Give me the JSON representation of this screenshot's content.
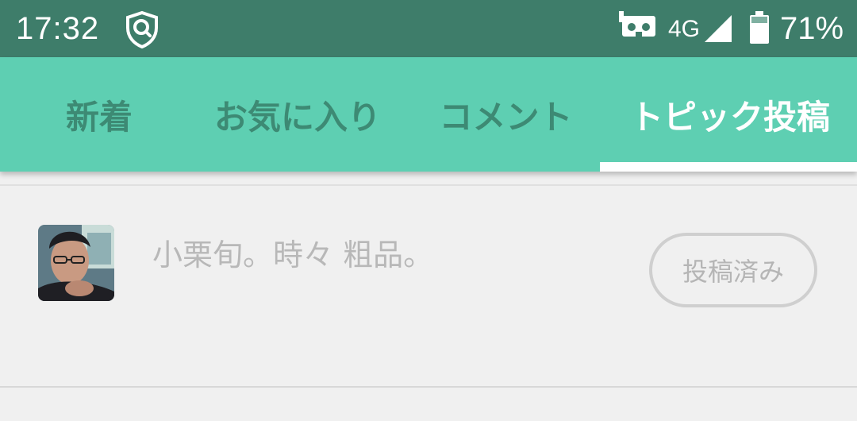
{
  "status_bar": {
    "time": "17:32",
    "shield_icon": "shield-search-icon",
    "vr_icon": "vr-headset-icon",
    "network": "4G",
    "signal_icon": "signal-icon",
    "battery_icon": "battery-icon",
    "battery_percent": "71%"
  },
  "tabs": [
    {
      "label": "新着",
      "active": false
    },
    {
      "label": "お気に入り",
      "active": false
    },
    {
      "label": "コメント",
      "active": false
    },
    {
      "label": "トピック投稿",
      "active": true
    }
  ],
  "colors": {
    "status_bar": "#3e7d6a",
    "tab_bar": "#5ecfb2",
    "tab_inactive_text": "#3d8a74",
    "tab_active_text": "#ffffff",
    "background": "#f0f0f0"
  },
  "topic_list": [
    {
      "avatar": "user-avatar-photo",
      "text": "小栗旬。時々 粗品。",
      "status_badge": "投稿済み"
    }
  ]
}
